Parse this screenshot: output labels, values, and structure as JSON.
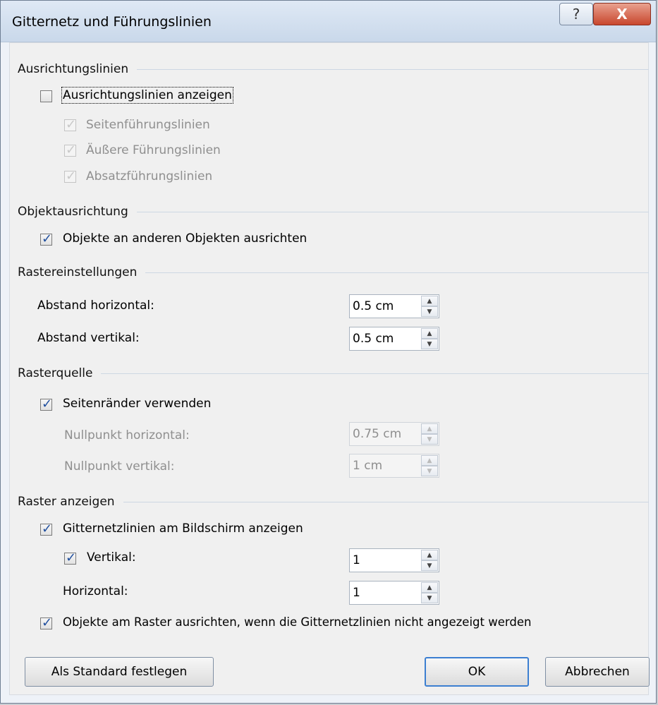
{
  "window": {
    "title": "Gitternetz und Führungslinien",
    "help_icon": "?",
    "close_icon": "X"
  },
  "ausrichtungslinien": {
    "header": "Ausrichtungslinien",
    "show_label": "Ausrichtungslinien anzeigen",
    "show_checked": false,
    "items": [
      {
        "label": "Seitenführungslinien",
        "checked": true
      },
      {
        "label": "Äußere Führungslinien",
        "checked": true
      },
      {
        "label": "Absatzführungslinien",
        "checked": true
      }
    ]
  },
  "objektausrichtung": {
    "header": "Objektausrichtung",
    "label": "Objekte an anderen Objekten ausrichten",
    "checked": true
  },
  "rastereinstellungen": {
    "header": "Rastereinstellungen",
    "horizontal_label": "Abstand horizontal:",
    "horizontal_value": "0.5 cm",
    "vertical_label": "Abstand vertikal:",
    "vertical_value": "0.5 cm"
  },
  "rasterquelle": {
    "header": "Rasterquelle",
    "margins_label": "Seitenränder verwenden",
    "margins_checked": true,
    "origin_h_label": "Nullpunkt horizontal:",
    "origin_h_value": "0.75 cm",
    "origin_v_label": "Nullpunkt vertikal:",
    "origin_v_value": "1 cm"
  },
  "raster_anzeigen": {
    "header": "Raster anzeigen",
    "gridlines_label": "Gitternetzlinien am Bildschirm anzeigen",
    "gridlines_checked": true,
    "vertical_label": "Vertikal:",
    "vertical_checked": true,
    "vertical_value": "1",
    "horizontal_label": "Horizontal:",
    "horizontal_value": "1",
    "snap_label": "Objekte am Raster ausrichten, wenn die Gitternetzlinien nicht angezeigt werden",
    "snap_checked": true
  },
  "buttons": {
    "default_label": "Als Standard festlegen",
    "ok_label": "OK",
    "cancel_label": "Abbrechen"
  }
}
